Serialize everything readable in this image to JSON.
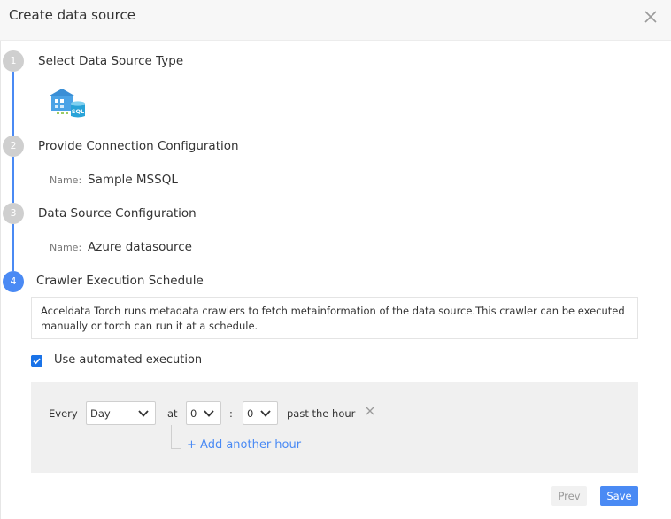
{
  "dialog": {
    "title": "Create data source"
  },
  "steps": [
    {
      "number": "1",
      "title": "Select Data Source Type",
      "state": "done"
    },
    {
      "number": "2",
      "title": "Provide Connection Configuration",
      "state": "done",
      "name_label": "Name:",
      "name_value": "Sample MSSQL"
    },
    {
      "number": "3",
      "title": "Data Source Configuration",
      "state": "done",
      "name_label": "Name:",
      "name_value": "Azure datasource"
    },
    {
      "number": "4",
      "title": "Crawler Execution Schedule",
      "state": "active"
    }
  ],
  "data_source_icon": "sql-database-icon",
  "crawler": {
    "description": "Acceldata Torch runs metadata crawlers to fetch metainformation of the data source.This crawler can be executed manually or torch can run it at a schedule.",
    "checkbox_label": "Use automated execution",
    "checkbox_checked": true
  },
  "schedule": {
    "every_label": "Every",
    "frequency": "Day",
    "at_label": "at",
    "hour": "0",
    "separator": ":",
    "minute": "0",
    "suffix": "past the hour",
    "add_label": "+ Add another hour"
  },
  "buttons": {
    "prev": "Prev",
    "save": "Save"
  },
  "colors": {
    "accent": "#4a8af4",
    "inactive_step": "#cfcfcf",
    "panel": "#f0f0f0"
  }
}
